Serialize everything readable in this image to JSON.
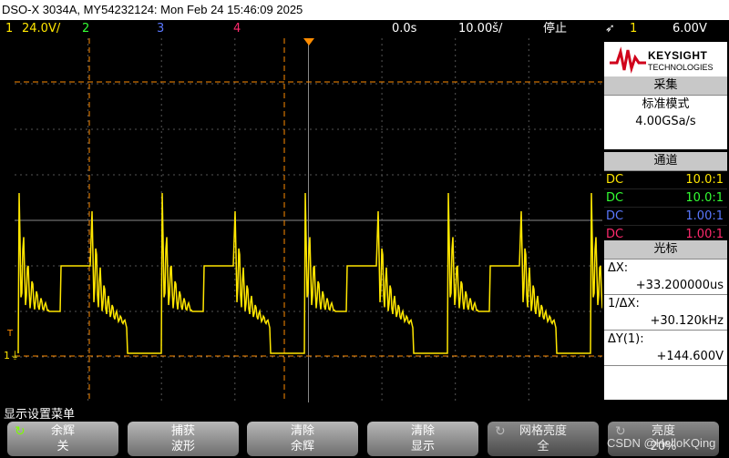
{
  "title": "DSO-X 3034A, MY54232124: Mon Feb 24 15:46:09 2025",
  "channels": {
    "ch1_num": "1",
    "ch1_scale": "24.0V/",
    "ch2_num": "2",
    "ch3_num": "3",
    "ch4_num": "4",
    "time_delay": "0.0s",
    "time_scale": "10.00š/",
    "run_state": "停止",
    "trigger_icon": "trigger-edge-icon",
    "trigger_channel": "1",
    "trigger_level": "6.00V"
  },
  "logo": {
    "brand": "KEYSIGHT",
    "sub": "TECHNOLOGIES"
  },
  "acquisition": {
    "header": "采集",
    "mode": "标准模式",
    "rate": "4.00GSa/s"
  },
  "channel_panel": {
    "header": "通道",
    "rows": [
      {
        "coupling": "DC",
        "probe": "10.0:1",
        "color": "#ffe600"
      },
      {
        "coupling": "DC",
        "probe": "10.0:1",
        "color": "#33ff33"
      },
      {
        "coupling": "DC",
        "probe": "1.00:1",
        "color": "#5a78ff"
      },
      {
        "coupling": "DC",
        "probe": "1.00:1",
        "color": "#ff2a6d"
      }
    ]
  },
  "cursors": {
    "header": "光标",
    "dx_label": "ΔX:",
    "dx_value": "+33.200000us",
    "invdx_label": "1/ΔX:",
    "invdx_value": "+30.120kHz",
    "dy_label": "ΔY(1):",
    "dy_value": "+144.600V"
  },
  "menu": {
    "title": "显示设置菜单",
    "keys": [
      {
        "line1": "余辉",
        "line2": "关",
        "icon": "rotate-icon"
      },
      {
        "line1": "捕获",
        "line2": "波形"
      },
      {
        "line1": "清除",
        "line2": "余辉"
      },
      {
        "line1": "清除",
        "line2": "显示"
      },
      {
        "line1": "网格亮度",
        "line2": "全",
        "icon": "rotate-icon"
      },
      {
        "line1": "亮度",
        "line2": "20%",
        "icon": "rotate-icon"
      }
    ]
  },
  "watermark": "CSDN @HelloKQing",
  "colors": {
    "ch1": "#ffe600",
    "ch2": "#33ff33",
    "ch3": "#5a78ff",
    "ch4": "#ff2a6d",
    "cursor": "#ff8c00"
  }
}
